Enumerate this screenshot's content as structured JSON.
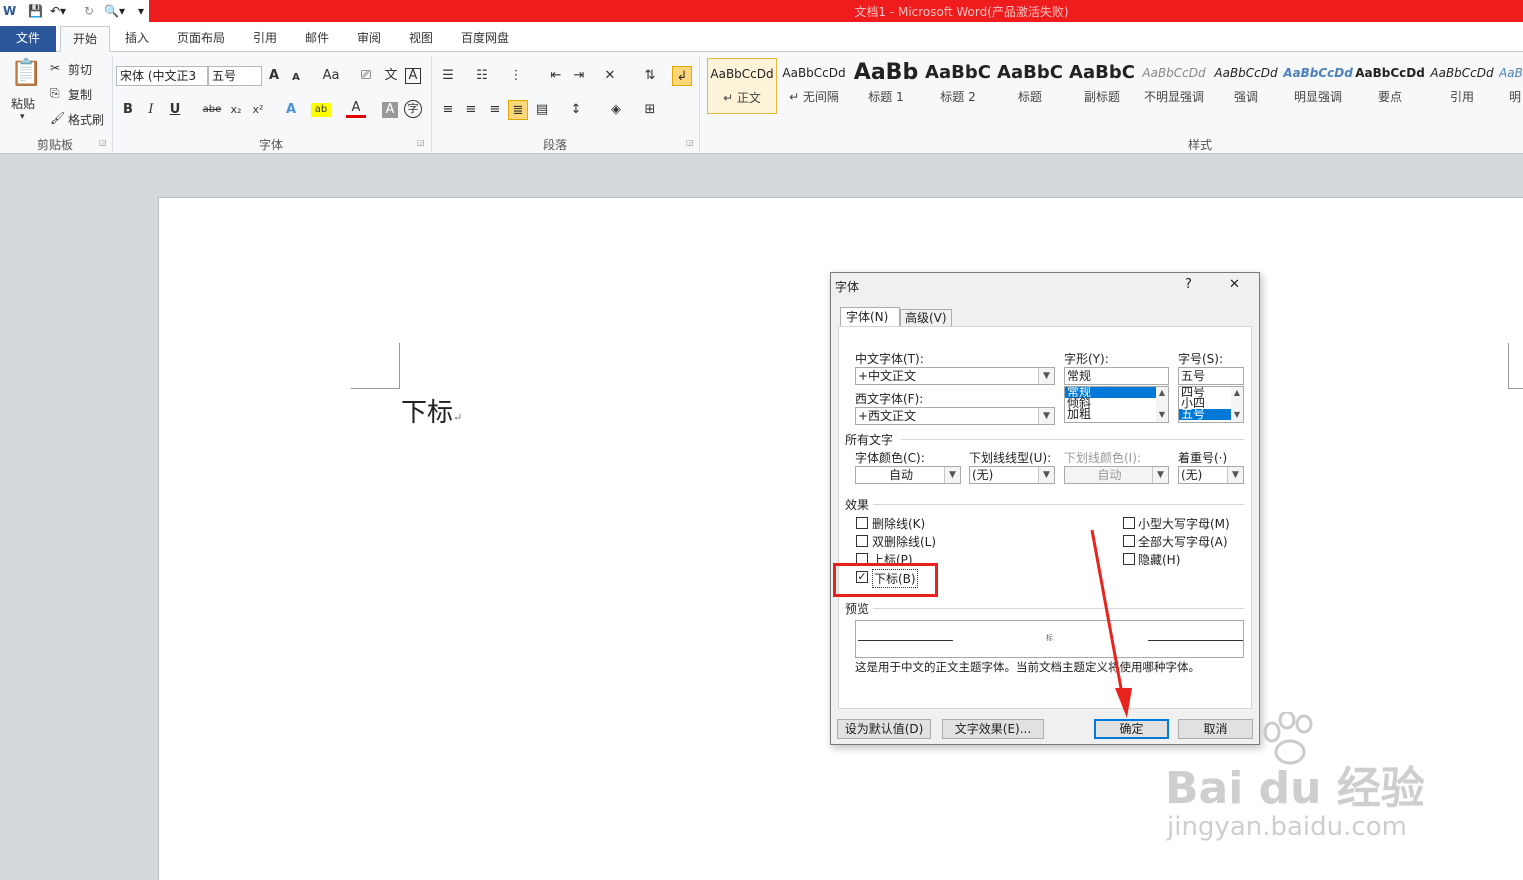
{
  "titlebar": {
    "title": "文档1 - Microsoft Word(产品激活失败)"
  },
  "tabs": [
    {
      "label": "文件"
    },
    {
      "label": "开始"
    },
    {
      "label": "插入"
    },
    {
      "label": "页面布局"
    },
    {
      "label": "引用"
    },
    {
      "label": "邮件"
    },
    {
      "label": "审阅"
    },
    {
      "label": "视图"
    },
    {
      "label": "百度网盘"
    }
  ],
  "ribbon": {
    "clipboard": {
      "paste": "粘贴",
      "cut": "剪切",
      "copy": "复制",
      "format_painter": "格式刷",
      "label": "剪贴板"
    },
    "font": {
      "font_name": "宋体 (中文正3",
      "font_size": "五号",
      "label": "字体",
      "grow": "A",
      "shrink": "A",
      "case": "Aa",
      "bold": "B",
      "italic": "I",
      "underline": "U",
      "strike": "abe",
      "sub": "x₂",
      "sup": "x²",
      "color": "A",
      "char_shade": "A",
      "enclose": "字"
    },
    "paragraph": {
      "label": "段落"
    },
    "styles": {
      "label": "样式",
      "items": [
        {
          "sample": "AaBbCcDd",
          "name": "↵ 正文"
        },
        {
          "sample": "AaBbCcDd",
          "name": "↵ 无间隔"
        },
        {
          "sample": "AaBb",
          "name": "标题 1"
        },
        {
          "sample": "AaBbC",
          "name": "标题 2"
        },
        {
          "sample": "AaBbC",
          "name": "标题"
        },
        {
          "sample": "AaBbC",
          "name": "副标题"
        },
        {
          "sample": "AaBbCcDd",
          "name": "不明显强调"
        },
        {
          "sample": "AaBbCcDd",
          "name": "强调"
        },
        {
          "sample": "AaBbCcDd",
          "name": "明显强调"
        },
        {
          "sample": "AaBbCcDd",
          "name": "要点"
        },
        {
          "sample": "AaBbCcDd",
          "name": "引用"
        },
        {
          "sample": "AaB",
          "name": "明"
        }
      ]
    }
  },
  "document": {
    "text": "下标",
    "para_mark": "↵"
  },
  "dialog": {
    "title": "字体",
    "help": "?",
    "close": "✕",
    "tabs": [
      {
        "label": "字体(N)"
      },
      {
        "label": "高级(V)"
      }
    ],
    "cn_font_label": "中文字体(T):",
    "cn_font_value": "+中文正文",
    "west_font_label": "西文字体(F):",
    "west_font_value": "+西文正文",
    "style_label": "字形(Y):",
    "style_value": "常规",
    "style_options": [
      "常规",
      "倾斜",
      "加粗"
    ],
    "size_label": "字号(S):",
    "size_value": "五号",
    "size_options": [
      "四号",
      "小四",
      "五号"
    ],
    "all_text_label": "所有文字",
    "color_label": "字体颜色(C):",
    "color_value": "自动",
    "underline_label": "下划线线型(U):",
    "underline_value": "(无)",
    "underline_color_label": "下划线颜色(I):",
    "underline_color_value": "自动",
    "emphasis_label": "着重号(·)",
    "emphasis_value": "(无)",
    "effects_label": "效果",
    "effects": [
      {
        "label": "删除线(K)",
        "checked": false
      },
      {
        "label": "双删除线(L)",
        "checked": false
      },
      {
        "label": "上标(P)",
        "checked": false
      },
      {
        "label": "下标(B)",
        "checked": true
      }
    ],
    "effects_right": [
      {
        "label": "小型大写字母(M)",
        "checked": false
      },
      {
        "label": "全部大写字母(A)",
        "checked": false
      },
      {
        "label": "隐藏(H)",
        "checked": false
      }
    ],
    "preview_label": "预览",
    "preview_sample": "标",
    "note": "这是用于中文的正文主题字体。当前文档主题定义将使用哪种字体。",
    "btn_default": "设为默认值(D)",
    "btn_effects": "文字效果(E)...",
    "btn_ok": "确定",
    "btn_cancel": "取消"
  },
  "watermark": {
    "line1": "Bai du 经验",
    "line2": "jingyan.baidu.com"
  },
  "colors": {
    "title_red": "#ee1c1c",
    "file_blue": "#2b579a",
    "annotation_red": "#e8231e"
  }
}
